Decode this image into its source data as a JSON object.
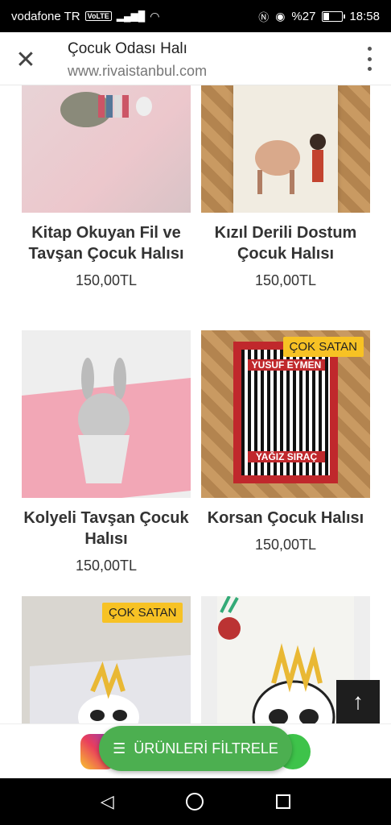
{
  "status": {
    "carrier": "vodafone TR",
    "volte": "VoLTE",
    "signal": "▂▄▆█",
    "wifi": "wifi-icon",
    "battery_text": "%27",
    "time": "18:58"
  },
  "browser": {
    "title": "Çocuk Odası Halı",
    "url": "www.rivaistanbul.com"
  },
  "products": [
    {
      "name": "Kitap Okuyan Fil ve Tavşan Çocuk Halısı",
      "price": "150,00TL",
      "badge": ""
    },
    {
      "name": "Kızıl Derili Dostum Çocuk Halısı",
      "price": "150,00TL",
      "badge": ""
    },
    {
      "name": "Kolyeli Tavşan Çocuk Halısı",
      "price": "150,00TL",
      "badge": ""
    },
    {
      "name": "Korsan Çocuk Halısı",
      "price": "150,00TL",
      "badge": "ÇOK SATAN"
    },
    {
      "name": "",
      "price": "",
      "badge": "ÇOK SATAN"
    },
    {
      "name": "",
      "price": "",
      "badge": ""
    }
  ],
  "rug_texts": {
    "korsan_top": "YUSUF EYMEN",
    "korsan_bottom": "YAĞIZ SIRAÇ"
  },
  "filter_button": "ÜRÜNLERİ FİLTRELE",
  "scroll_top_icon": "arrow-up-icon"
}
